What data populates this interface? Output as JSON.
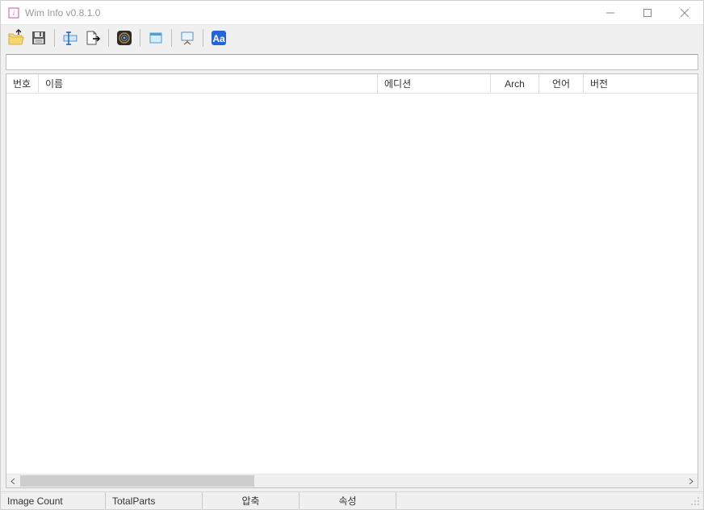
{
  "window": {
    "title": "Wim Info v0.8.1.0"
  },
  "toolbar": {
    "open": "open",
    "save": "save",
    "rename": "rename",
    "export": "export",
    "tool": "tool",
    "window": "window",
    "presentation": "presentation",
    "font": "font"
  },
  "columns": {
    "number": "번호",
    "name": "이름",
    "edition": "에디션",
    "arch": "Arch",
    "language": "언어",
    "version": "버전"
  },
  "statusbar": {
    "imageCount": "Image Count",
    "totalParts": "TotalParts",
    "compression": "압축",
    "attributes": "속성"
  }
}
